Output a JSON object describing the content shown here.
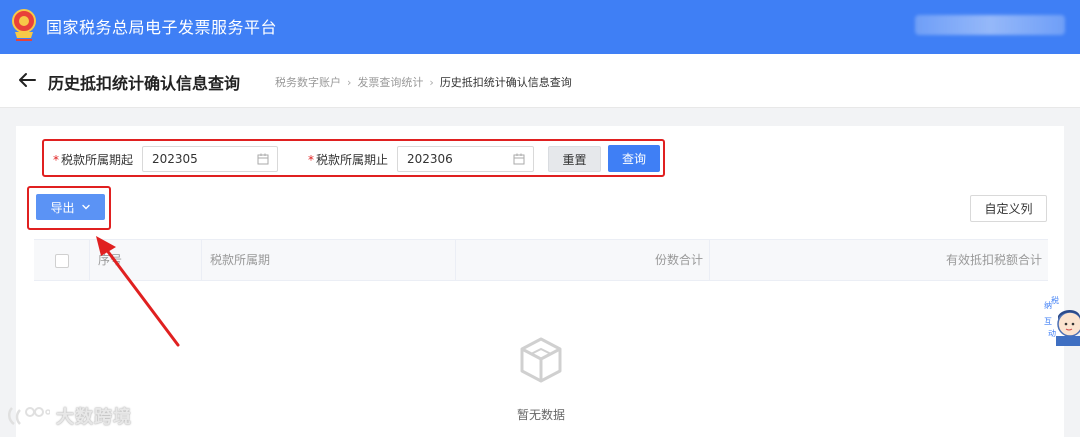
{
  "header": {
    "platform_title": "国家税务总局电子发票服务平台",
    "user_name_blurred": "",
    "brand_color": "#3f7ff5"
  },
  "page": {
    "title": "历史抵扣统计确认信息查询",
    "breadcrumb": [
      "税务数字账户",
      "发票查询统计",
      "历史抵扣统计确认信息查询"
    ]
  },
  "filters": {
    "start_label": "税款所属期起",
    "start_value": "202305",
    "end_label": "税款所属期止",
    "end_value": "202306",
    "required_mark": "*",
    "reset_label": "重置",
    "query_label": "查询"
  },
  "toolbar": {
    "export_label": "导出",
    "custom_columns_label": "自定义列"
  },
  "table": {
    "columns": [
      "序号",
      "税款所属期",
      "份数合计",
      "有效抵扣税额合计"
    ],
    "empty_text": "暂无数据"
  },
  "watermark": {
    "text": "大数跨境"
  },
  "assistant": {
    "text": [
      "纳",
      "税",
      "互",
      "动"
    ]
  },
  "annotation_color": "#e02020"
}
